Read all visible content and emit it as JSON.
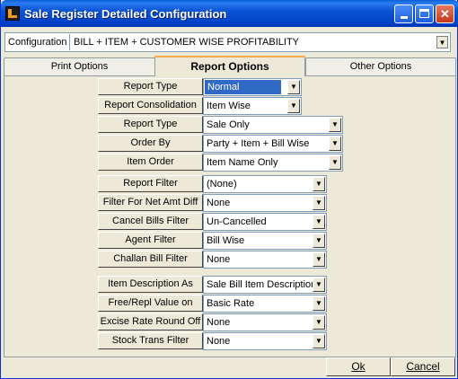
{
  "window": {
    "title": "Sale Register Detailed Configuration"
  },
  "config": {
    "label": "Configuration",
    "value": "BILL + ITEM + CUSTOMER WISE PROFITABILITY"
  },
  "tabs": [
    {
      "label": "Print Options"
    },
    {
      "label": "Report Options"
    },
    {
      "label": "Other Options"
    }
  ],
  "fields": [
    {
      "label": "Report Type",
      "value": "Normal"
    },
    {
      "label": "Report Consolidation",
      "value": "Item Wise"
    },
    {
      "label": "Report Type",
      "value": "Sale Only"
    },
    {
      "label": "Order By",
      "value": "Party + Item + Bill Wise"
    },
    {
      "label": "Item Order",
      "value": "Item Name Only"
    },
    {
      "label": "Report Filter",
      "value": "(None)"
    },
    {
      "label": "Filter For Net Amt Diff",
      "value": "None"
    },
    {
      "label": "Cancel Bills Filter",
      "value": "Un-Cancelled"
    },
    {
      "label": "Agent Filter",
      "value": "Bill Wise"
    },
    {
      "label": "Challan Bill Filter",
      "value": "None"
    },
    {
      "label": "Item Description As",
      "value": "Sale Bill Item Description"
    },
    {
      "label": "Free/Repl Value on",
      "value": "Basic Rate"
    },
    {
      "label": "Excise Rate Round Off",
      "value": "None"
    },
    {
      "label": "Stock Trans Filter",
      "value": "None"
    }
  ],
  "buttons": {
    "ok": "Ok",
    "cancel": "Cancel"
  },
  "colors": {
    "titlebar": "#0a54d4",
    "accent_tab": "#f7a84a",
    "selection": "#316ac5",
    "face": "#ece9d8"
  }
}
